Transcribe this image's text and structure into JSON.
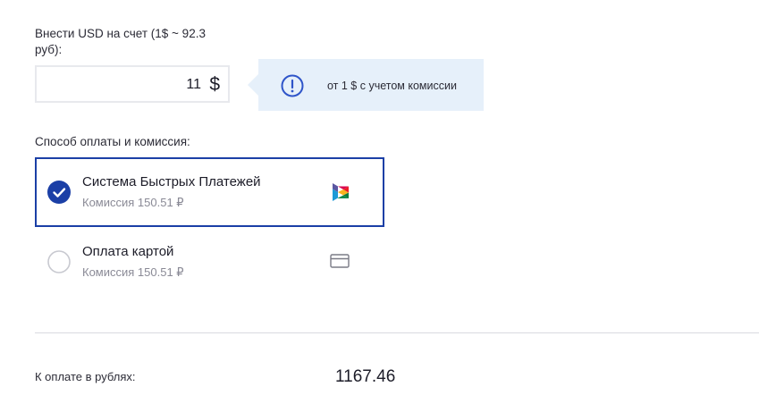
{
  "deposit": {
    "label": "Внести USD на счет (1$ ~ 92.3 руб):",
    "amount": "11",
    "currency_symbol": "$"
  },
  "hint": {
    "icon": "info-circle-icon",
    "text": "от 1 $ с учетом комиссии"
  },
  "payment": {
    "heading": "Способ оплаты и комиссия:",
    "methods": [
      {
        "title": "Система Быстрых Платежей",
        "fee": "Комиссия 150.51 ₽",
        "selected": true,
        "icon": "sbp-logo-icon"
      },
      {
        "title": "Оплата картой",
        "fee": "Комиссия 150.51 ₽",
        "selected": false,
        "icon": "credit-card-icon"
      }
    ]
  },
  "total": {
    "label": "К оплате в рублях:",
    "value": "1167.46"
  },
  "colors": {
    "accent": "#1b3fa6",
    "hint_background": "#e6f0fa",
    "muted_text": "#8a8a96"
  }
}
